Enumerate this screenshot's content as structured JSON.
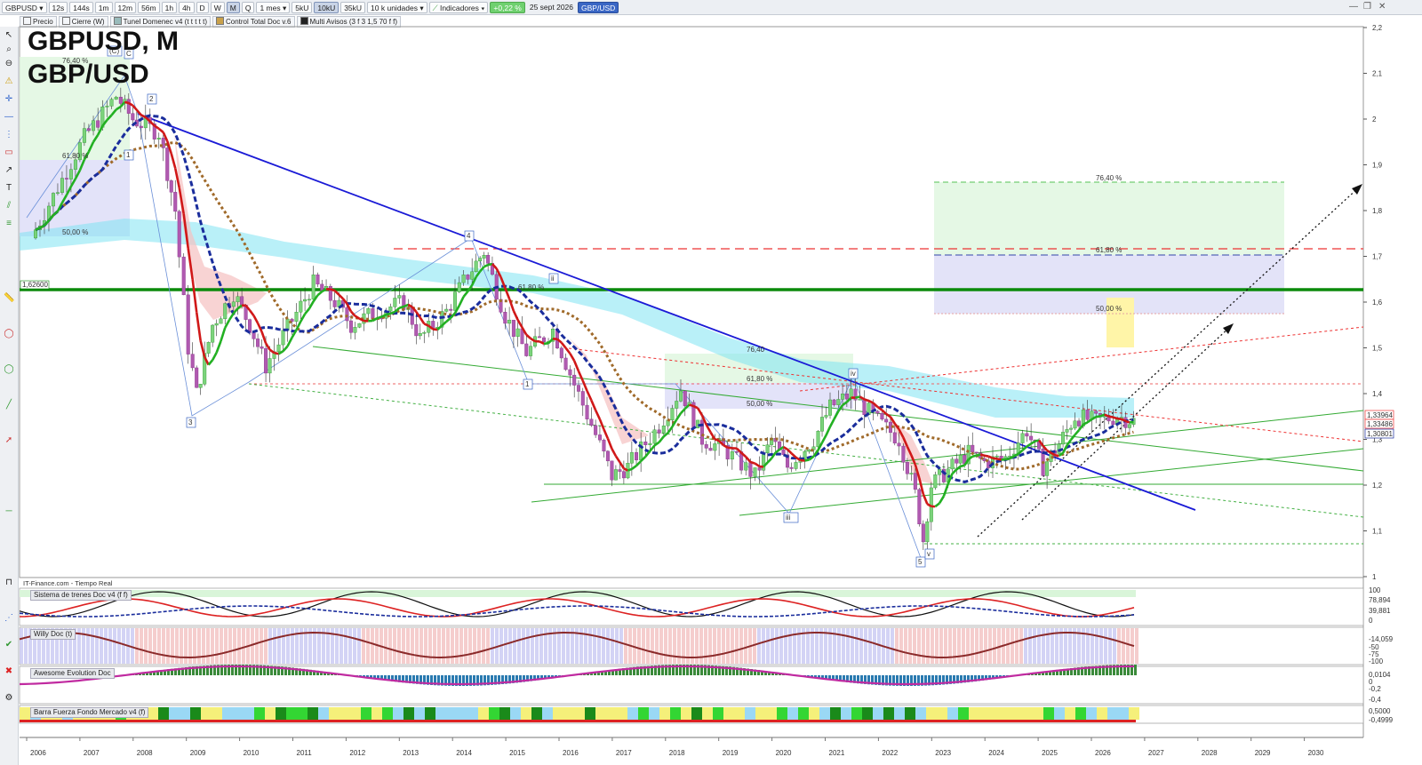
{
  "toolbar": {
    "symbol": "GBPUSD",
    "timeframes": [
      "12s",
      "144s",
      "1m",
      "12m",
      "56m",
      "1h",
      "4h",
      "D",
      "W",
      "M",
      "Q"
    ],
    "active_timeframe": "M",
    "period": "1 mes",
    "units_options": [
      "5kU",
      "10kU",
      "35kU"
    ],
    "active_units": "10kU",
    "units_select": "10 k unidades",
    "indicators_button": "Indicadores",
    "change": "+0,22 %",
    "date": "25 sept 2026",
    "instrument_tag": "GBP/USD"
  },
  "indicator_bar": [
    "Precio",
    "Cierre (W)",
    "Tunel Domenec v4 (t t t t t)",
    "Control Total Doc v.6",
    "Multi Avisos (3 f 3 1,5 70 f f)"
  ],
  "chart_title": {
    "line1": "GBPUSD, M",
    "line2": "GBP/USD"
  },
  "source_label": "IT-Finance.com - Tiempo Real",
  "price_axis": {
    "ticks": [
      "2,2",
      "2,1",
      "2",
      "1,9",
      "1,8",
      "1,7",
      "1,6",
      "1,5",
      "1,4",
      "1,3",
      "1,2",
      "1,1",
      "1"
    ],
    "current_labels": [
      "1,33964",
      "1,33486",
      "1,30801"
    ],
    "level_label": "1,62600"
  },
  "time_axis": [
    "2006",
    "2007",
    "2008",
    "2009",
    "2010",
    "2011",
    "2012",
    "2013",
    "2014",
    "2015",
    "2016",
    "2017",
    "2018",
    "2019",
    "2020",
    "2021",
    "2022",
    "2023",
    "2024",
    "2025",
    "2026",
    "2027",
    "2028",
    "2029",
    "2030"
  ],
  "fib_labels": {
    "top_left": [
      "76,40 %",
      "61,80 %",
      "50,00 %"
    ],
    "mid": [
      "61,80 %",
      "76,40",
      "61,80 %",
      "50,00 %"
    ],
    "right": [
      "76,40 %",
      "61,80 %",
      "50,00 %"
    ]
  },
  "wave_labels": [
    "(C)",
    "C",
    "2",
    "1",
    "3",
    "4",
    "ii",
    "1",
    "iv",
    "iii",
    "5",
    "v"
  ],
  "panels": [
    {
      "name": "Sistema de trenes Doc v4 (f f)",
      "values": [
        "100",
        "78,894",
        "39,881",
        "0"
      ]
    },
    {
      "name": "Willy Doc (t)",
      "values": [
        "-14,059",
        "-50",
        "-75",
        "-100"
      ]
    },
    {
      "name": "Awesome Evolution Doc",
      "values": [
        "0,0104",
        "0",
        "-0,2",
        "-0,4"
      ]
    },
    {
      "name": "Barra Fuerza Fondo Mercado v4 (f)",
      "values": [
        "0,5000",
        "-0,4999"
      ]
    }
  ],
  "colors": {
    "down_trendline": "#1a1ad6",
    "support_level": "#0b8a0b",
    "ma_red": "#d01818",
    "ma_green": "#22b022",
    "dashed_blue": "#1a2d9c",
    "dotted_brown": "#a06a2a",
    "cloud": "#7fe3f3"
  }
}
